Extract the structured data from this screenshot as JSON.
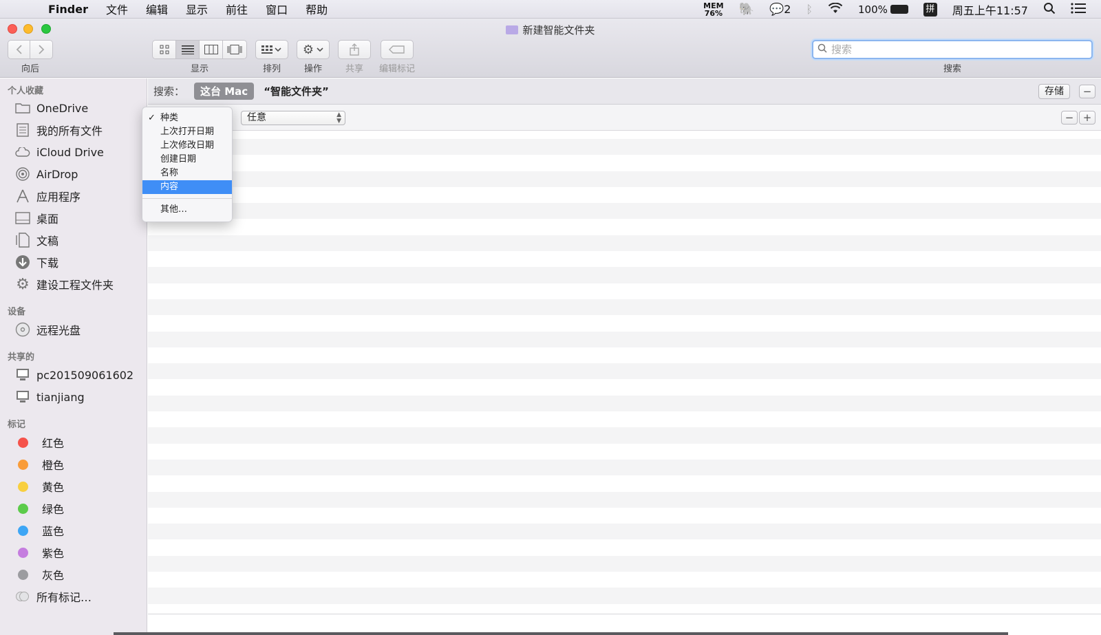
{
  "menubar": {
    "app": "Finder",
    "items": [
      "文件",
      "编辑",
      "显示",
      "前往",
      "窗口",
      "帮助"
    ],
    "mem_label": "MEM",
    "mem_value": "76%",
    "wechat_count": "2",
    "battery": "100%",
    "input_method": "拼",
    "clock": "周五上午11:57"
  },
  "window": {
    "title": "新建智能文件夹",
    "toolbar": {
      "back_label": "向后",
      "view_label": "显示",
      "arrange_label": "排列",
      "action_label": "操作",
      "share_label": "共享",
      "tags_label": "编辑标记",
      "search_label": "搜索",
      "search_placeholder": "搜索"
    }
  },
  "sidebar": {
    "favorites_title": "个人收藏",
    "favorites": [
      {
        "label": "OneDrive",
        "icon": "folder-icon"
      },
      {
        "label": "我的所有文件",
        "icon": "all-files-icon"
      },
      {
        "label": "iCloud Drive",
        "icon": "cloud-icon"
      },
      {
        "label": "AirDrop",
        "icon": "airdrop-icon"
      },
      {
        "label": "应用程序",
        "icon": "applications-icon"
      },
      {
        "label": "桌面",
        "icon": "desktop-icon"
      },
      {
        "label": "文稿",
        "icon": "documents-icon"
      },
      {
        "label": "下载",
        "icon": "download-icon"
      },
      {
        "label": "建设工程文件夹",
        "icon": "gear-icon"
      }
    ],
    "devices_title": "设备",
    "devices": [
      {
        "label": "远程光盘",
        "icon": "disc-icon"
      }
    ],
    "shared_title": "共享的",
    "shared": [
      {
        "label": "pc201509061602",
        "icon": "computer-icon"
      },
      {
        "label": "tianjiang",
        "icon": "computer-icon"
      }
    ],
    "tags_title": "标记",
    "tags": [
      {
        "label": "红色",
        "color": "#f5524a"
      },
      {
        "label": "橙色",
        "color": "#f99c39"
      },
      {
        "label": "黄色",
        "color": "#f8cf3f"
      },
      {
        "label": "绿色",
        "color": "#5ccb4a"
      },
      {
        "label": "蓝色",
        "color": "#3ea6f5"
      },
      {
        "label": "紫色",
        "color": "#c57ddf"
      },
      {
        "label": "灰色",
        "color": "#9c9ca0"
      }
    ],
    "all_tags": "所有标记…"
  },
  "main": {
    "search_label": "搜索：",
    "scope_mac": "这台 Mac",
    "scope_folder": "“智能文件夹”",
    "save_label": "存储",
    "criteria_value": "任意"
  },
  "dropdown": {
    "items": [
      "种类",
      "上次打开日期",
      "上次修改日期",
      "创建日期",
      "名称",
      "内容"
    ],
    "checked_index": 0,
    "selected_index": 5,
    "other": "其他…"
  }
}
